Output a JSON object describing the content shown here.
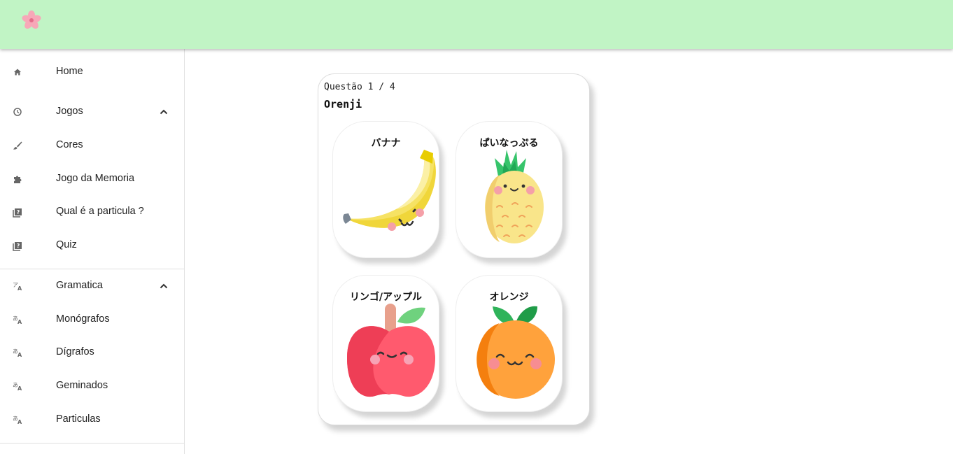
{
  "sidebar": {
    "items": [
      {
        "label": "Home",
        "icon": "home-icon"
      },
      {
        "label": "Jogos",
        "icon": "history-icon",
        "expanded": true
      },
      {
        "label": "Cores",
        "icon": "brush-icon"
      },
      {
        "label": "Jogo da Memoria",
        "icon": "puzzle-icon"
      },
      {
        "label": "Qual é a particula ?",
        "icon": "quiz-icon"
      },
      {
        "label": "Quiz",
        "icon": "quiz-icon"
      },
      {
        "label": "Gramatica",
        "icon": "translate-icon",
        "expanded": true
      },
      {
        "label": "Monógrafos",
        "icon": "translate-icon"
      },
      {
        "label": "Dígrafos",
        "icon": "translate-icon"
      },
      {
        "label": "Geminados",
        "icon": "translate-icon"
      },
      {
        "label": "Particulas",
        "icon": "translate-icon"
      }
    ]
  },
  "quiz": {
    "counter": "Questão 1 / 4",
    "word": "Orenji",
    "options": [
      {
        "label": "バナナ",
        "image": "banana"
      },
      {
        "label": "ぱいなっぷる",
        "image": "pineapple"
      },
      {
        "label": "リンゴ/アップル",
        "image": "apple"
      },
      {
        "label": "オレンジ",
        "image": "orange"
      }
    ]
  },
  "colors": {
    "appbar": "#c1f4c5",
    "sidebar_icon": "#666666"
  }
}
